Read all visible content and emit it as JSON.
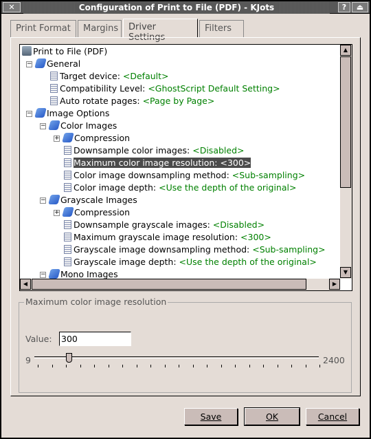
{
  "window": {
    "title": "Configuration of Print to File (PDF) - KJots",
    "close_glyph": "✕",
    "help_glyph": "?",
    "shade_glyph": "⏏"
  },
  "tabs": [
    {
      "label": "Print Format"
    },
    {
      "label": "Margins"
    },
    {
      "label": "Driver Settings",
      "active": true
    },
    {
      "label": "Filters"
    }
  ],
  "tree": {
    "rows": [
      {
        "level": 0,
        "icon": "printer-icon",
        "label": "Print to File (PDF)",
        "value": ""
      },
      {
        "level": 1,
        "icon": "folder-icon",
        "label": "General",
        "value": "",
        "expanded": true
      },
      {
        "level": 2,
        "icon": "document-icon",
        "label": "Target device: ",
        "value": "<Default>"
      },
      {
        "level": 2,
        "icon": "document-icon",
        "label": "Compatibility Level: ",
        "value": "<GhostScript Default Setting>"
      },
      {
        "level": 2,
        "icon": "document-icon",
        "label": "Auto rotate pages: ",
        "value": "<Page by Page>"
      },
      {
        "level": 1,
        "icon": "folder-icon",
        "label": "Image Options",
        "value": "",
        "expanded": true
      },
      {
        "level": 2,
        "icon": "folder-icon",
        "label": "Color Images",
        "value": "",
        "expanded": true
      },
      {
        "level": 3,
        "icon": "folder-icon",
        "label": "Compression",
        "value": "",
        "expanded": false
      },
      {
        "level": 3,
        "icon": "document-icon",
        "label": "Downsample color images: ",
        "value": "<Disabled>"
      },
      {
        "level": 3,
        "icon": "document-icon",
        "label": "Maximum color image resolution: ",
        "value": "<300>",
        "selected": true
      },
      {
        "level": 3,
        "icon": "document-icon",
        "label": "Color image downsampling method: ",
        "value": "<Sub-sampling>"
      },
      {
        "level": 3,
        "icon": "document-icon",
        "label": "Color image depth: ",
        "value": "<Use the depth of the original>"
      },
      {
        "level": 2,
        "icon": "folder-icon",
        "label": "Grayscale Images",
        "value": "",
        "expanded": true
      },
      {
        "level": 3,
        "icon": "folder-icon",
        "label": "Compression",
        "value": "",
        "expanded": false
      },
      {
        "level": 3,
        "icon": "document-icon",
        "label": "Downsample grayscale images: ",
        "value": "<Disabled>"
      },
      {
        "level": 3,
        "icon": "document-icon",
        "label": "Maximum grayscale image resolution: ",
        "value": "<300>"
      },
      {
        "level": 3,
        "icon": "document-icon",
        "label": "Grayscale image downsampling method: ",
        "value": "<Sub-sampling>"
      },
      {
        "level": 3,
        "icon": "document-icon",
        "label": "Grayscale image depth: ",
        "value": "<Use the depth of the original>"
      },
      {
        "level": 2,
        "icon": "folder-icon",
        "label": "Mono Images",
        "value": "",
        "expanded": true
      }
    ]
  },
  "option": {
    "group_title": "Maximum color image resolution",
    "value_label": "Value:",
    "value": "300",
    "min": "9",
    "max": "2400",
    "slider_value": 300,
    "tick_count": 21
  },
  "buttons": {
    "save": "Save",
    "ok": "OK",
    "cancel": "Cancel"
  }
}
